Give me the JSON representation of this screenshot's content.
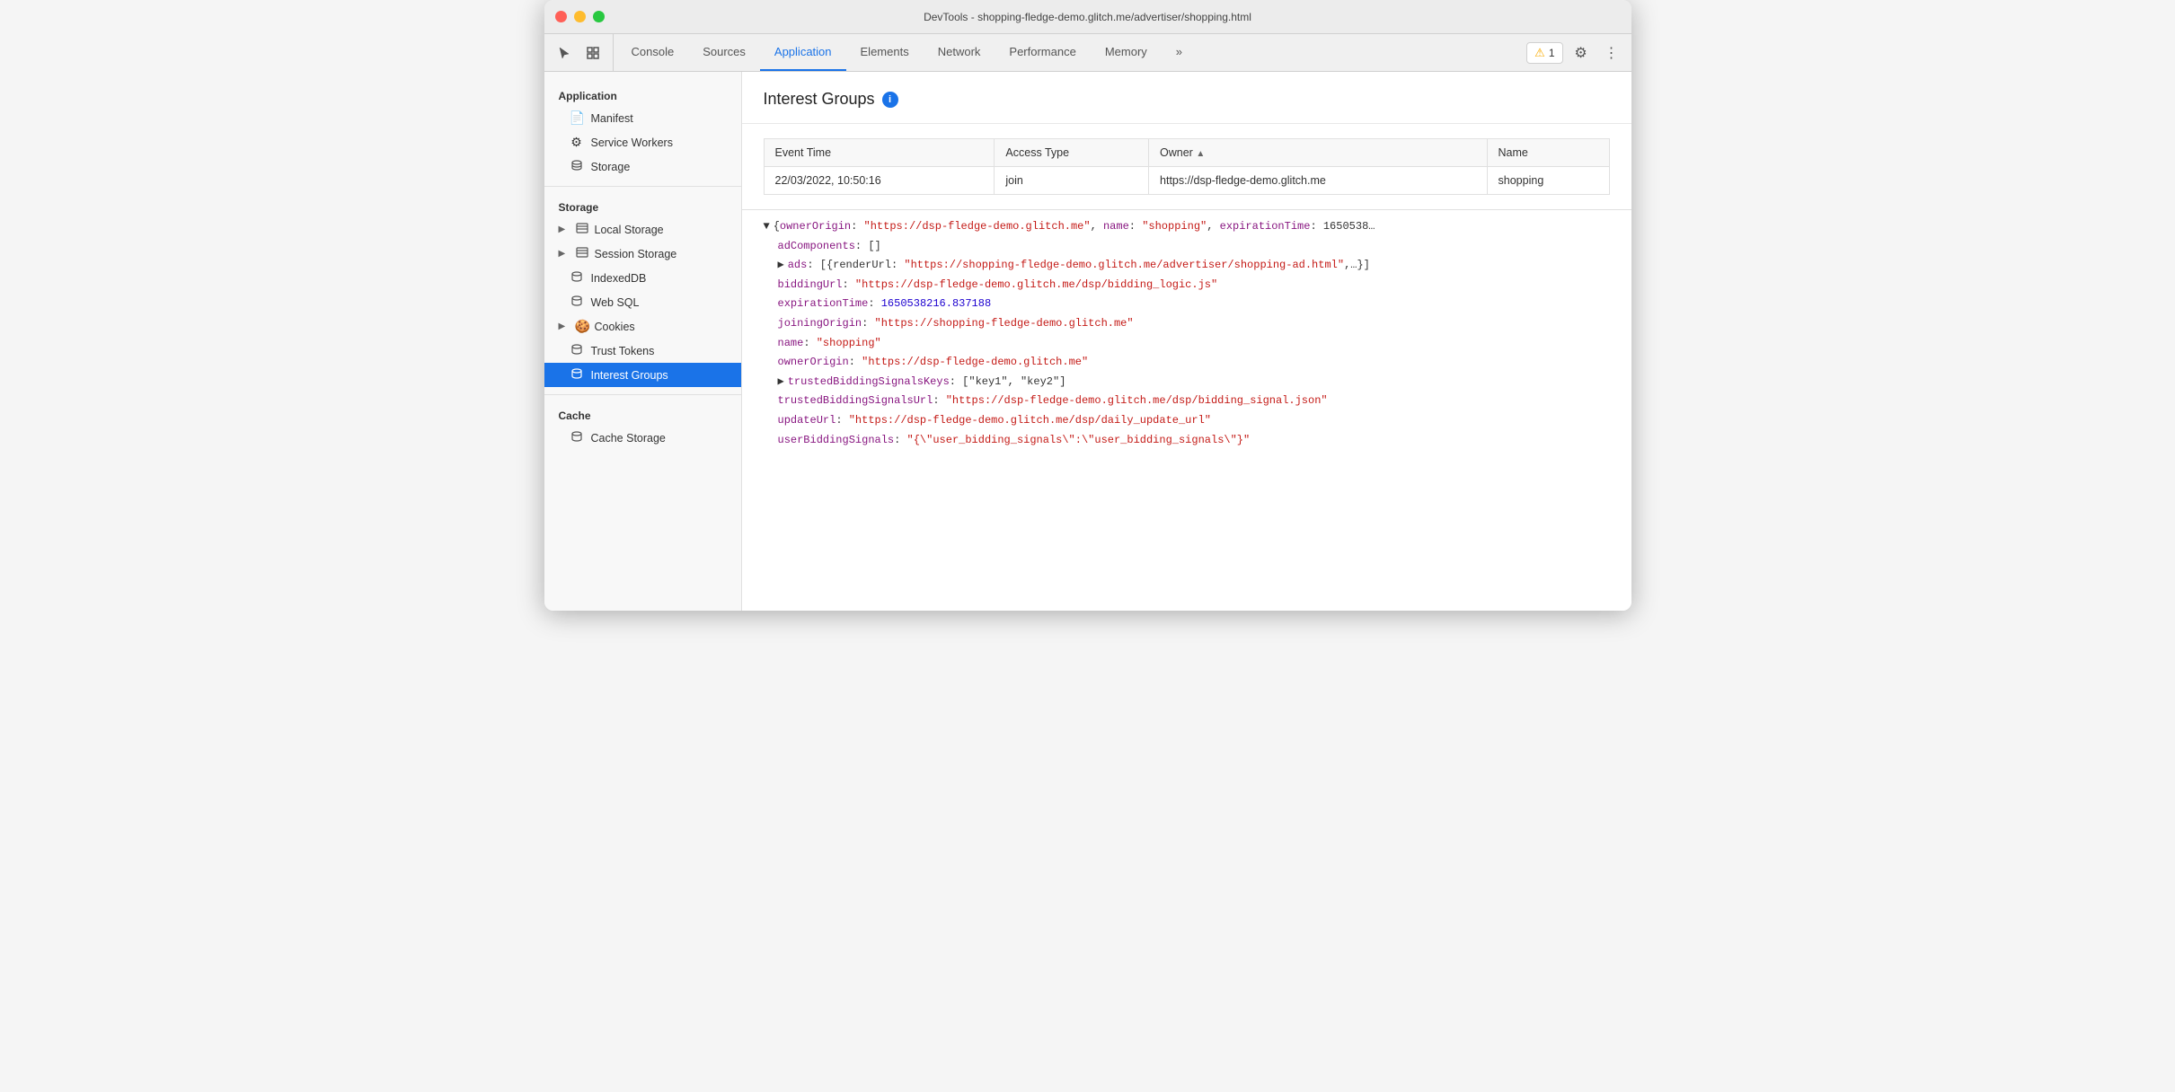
{
  "titlebar": {
    "title": "DevTools - shopping-fledge-demo.glitch.me/advertiser/shopping.html"
  },
  "toolbar": {
    "tabs": [
      {
        "id": "console",
        "label": "Console",
        "active": false
      },
      {
        "id": "sources",
        "label": "Sources",
        "active": false
      },
      {
        "id": "application",
        "label": "Application",
        "active": true
      },
      {
        "id": "elements",
        "label": "Elements",
        "active": false
      },
      {
        "id": "network",
        "label": "Network",
        "active": false
      },
      {
        "id": "performance",
        "label": "Performance",
        "active": false
      },
      {
        "id": "memory",
        "label": "Memory",
        "active": false
      }
    ],
    "warning_count": "1",
    "more_label": "»"
  },
  "sidebar": {
    "sections": [
      {
        "id": "application",
        "title": "Application",
        "items": [
          {
            "id": "manifest",
            "label": "Manifest",
            "icon": "📄",
            "indent": true
          },
          {
            "id": "service-workers",
            "label": "Service Workers",
            "icon": "⚙",
            "indent": true
          },
          {
            "id": "storage",
            "label": "Storage",
            "icon": "🗄",
            "indent": true
          }
        ]
      },
      {
        "id": "storage",
        "title": "Storage",
        "items": [
          {
            "id": "local-storage",
            "label": "Local Storage",
            "icon": "▦",
            "indent": false,
            "expandable": true
          },
          {
            "id": "session-storage",
            "label": "Session Storage",
            "icon": "▦",
            "indent": false,
            "expandable": true
          },
          {
            "id": "indexeddb",
            "label": "IndexedDB",
            "icon": "🗄",
            "indent": false
          },
          {
            "id": "web-sql",
            "label": "Web SQL",
            "icon": "🗄",
            "indent": false
          },
          {
            "id": "cookies",
            "label": "Cookies",
            "icon": "🍪",
            "indent": false,
            "expandable": true
          },
          {
            "id": "trust-tokens",
            "label": "Trust Tokens",
            "icon": "🗄",
            "indent": false
          },
          {
            "id": "interest-groups",
            "label": "Interest Groups",
            "icon": "🗄",
            "indent": false,
            "active": true
          }
        ]
      },
      {
        "id": "cache",
        "title": "Cache",
        "items": [
          {
            "id": "cache-storage",
            "label": "Cache Storage",
            "icon": "🗄",
            "indent": false
          }
        ]
      }
    ]
  },
  "content": {
    "page_title": "Interest Groups",
    "table": {
      "columns": [
        {
          "id": "event-time",
          "label": "Event Time"
        },
        {
          "id": "access-type",
          "label": "Access Type"
        },
        {
          "id": "owner",
          "label": "Owner",
          "sorted": true
        },
        {
          "id": "name",
          "label": "Name"
        }
      ],
      "rows": [
        {
          "event_time": "22/03/2022, 10:50:16",
          "access_type": "join",
          "owner": "https://dsp-fledge-demo.glitch.me",
          "name": "shopping"
        }
      ]
    },
    "detail": {
      "root_line": "▼ {ownerOrigin: \"https://dsp-fledge-demo.glitch.me\", name: \"shopping\", expirationTime: 1650538…",
      "lines": [
        {
          "indent": 1,
          "key": "adComponents",
          "value": "[]",
          "type": "plain"
        },
        {
          "indent": 1,
          "key": "ads",
          "value": "[{renderUrl: \"https://shopping-fledge-demo.glitch.me/advertiser/shopping-ad.html\",…}]",
          "type": "plain",
          "expandable": true
        },
        {
          "indent": 1,
          "key": "biddingUrl",
          "value": "\"https://dsp-fledge-demo.glitch.me/dsp/bidding_logic.js\"",
          "type": "str"
        },
        {
          "indent": 1,
          "key": "expirationTime",
          "value": "1650538216.837188",
          "type": "num"
        },
        {
          "indent": 1,
          "key": "joiningOrigin",
          "value": "\"https://shopping-fledge-demo.glitch.me\"",
          "type": "str"
        },
        {
          "indent": 1,
          "key": "name",
          "value": "\"shopping\"",
          "type": "str"
        },
        {
          "indent": 1,
          "key": "ownerOrigin",
          "value": "\"https://dsp-fledge-demo.glitch.me\"",
          "type": "str"
        },
        {
          "indent": 1,
          "key": "trustedBiddingSignalsKeys",
          "value": "[\"key1\", \"key2\"]",
          "type": "plain",
          "expandable": true
        },
        {
          "indent": 1,
          "key": "trustedBiddingSignalsUrl",
          "value": "\"https://dsp-fledge-demo.glitch.me/dsp/bidding_signal.json\"",
          "type": "str"
        },
        {
          "indent": 1,
          "key": "updateUrl",
          "value": "\"https://dsp-fledge-demo.glitch.me/dsp/daily_update_url\"",
          "type": "str"
        },
        {
          "indent": 1,
          "key": "userBiddingSignals",
          "value": "\"{\\\"user_bidding_signals\\\":\\\"user_bidding_signals\\\"}\"",
          "type": "str"
        }
      ]
    }
  }
}
